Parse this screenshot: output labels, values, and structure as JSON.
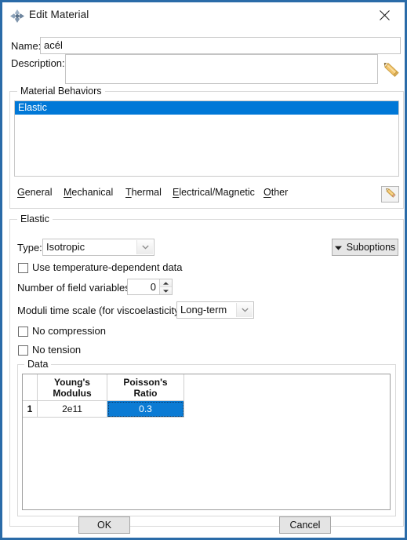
{
  "window": {
    "title": "Edit Material",
    "icon": "abaqus-diamond-icon",
    "close_label": "close-icon",
    "border_color": "#2a6ba8"
  },
  "form": {
    "name_label": "Name:",
    "name_value": "acél",
    "name_placeholder": "",
    "description_label": "Description:",
    "description_value": "",
    "description_placeholder": "",
    "edit_description_icon": "pencil-icon"
  },
  "material_behaviors": {
    "group_title": "Material Behaviors",
    "items": [
      {
        "label": "Elastic",
        "selected": true
      }
    ],
    "menu": [
      {
        "label": "General",
        "accel": "G"
      },
      {
        "label": "Mechanical",
        "accel": "M"
      },
      {
        "label": "Thermal",
        "accel": "T"
      },
      {
        "label": "Electrical/Magnetic",
        "accel": "E"
      },
      {
        "label": "Other",
        "accel": "O"
      }
    ],
    "edit_button_icon": "pencil-icon"
  },
  "elastic": {
    "group_title": "Elastic",
    "type_label": "Type:",
    "type_value": "Isotropic",
    "type_options": [
      "Isotropic"
    ],
    "suboptions_label": "Suboptions",
    "suboptions_arrow": "triangle-down-icon",
    "use_temp_dependent_label": "Use temperature-dependent data",
    "use_temp_dependent_checked": false,
    "field_variables_label": "Number of field variables:",
    "field_variables_value": "0",
    "moduli_label": "Moduli time scale (for viscoelasticity):",
    "moduli_value": "Long-term",
    "moduli_options": [
      "Long-term"
    ],
    "no_compression_label": "No compression",
    "no_compression_checked": false,
    "no_tension_label": "No tension",
    "no_tension_checked": false
  },
  "data": {
    "group_title": "Data",
    "columns": [
      {
        "line1": "Young's",
        "line2": "Modulus"
      },
      {
        "line1": "Poisson's",
        "line2": "Ratio"
      }
    ],
    "rows": [
      {
        "index": "1",
        "values": [
          "2e11",
          "0.3"
        ],
        "selected_col": 1
      }
    ],
    "selection_color": "#0b7bd4"
  },
  "footer": {
    "ok_label": "OK",
    "cancel_label": "Cancel"
  }
}
